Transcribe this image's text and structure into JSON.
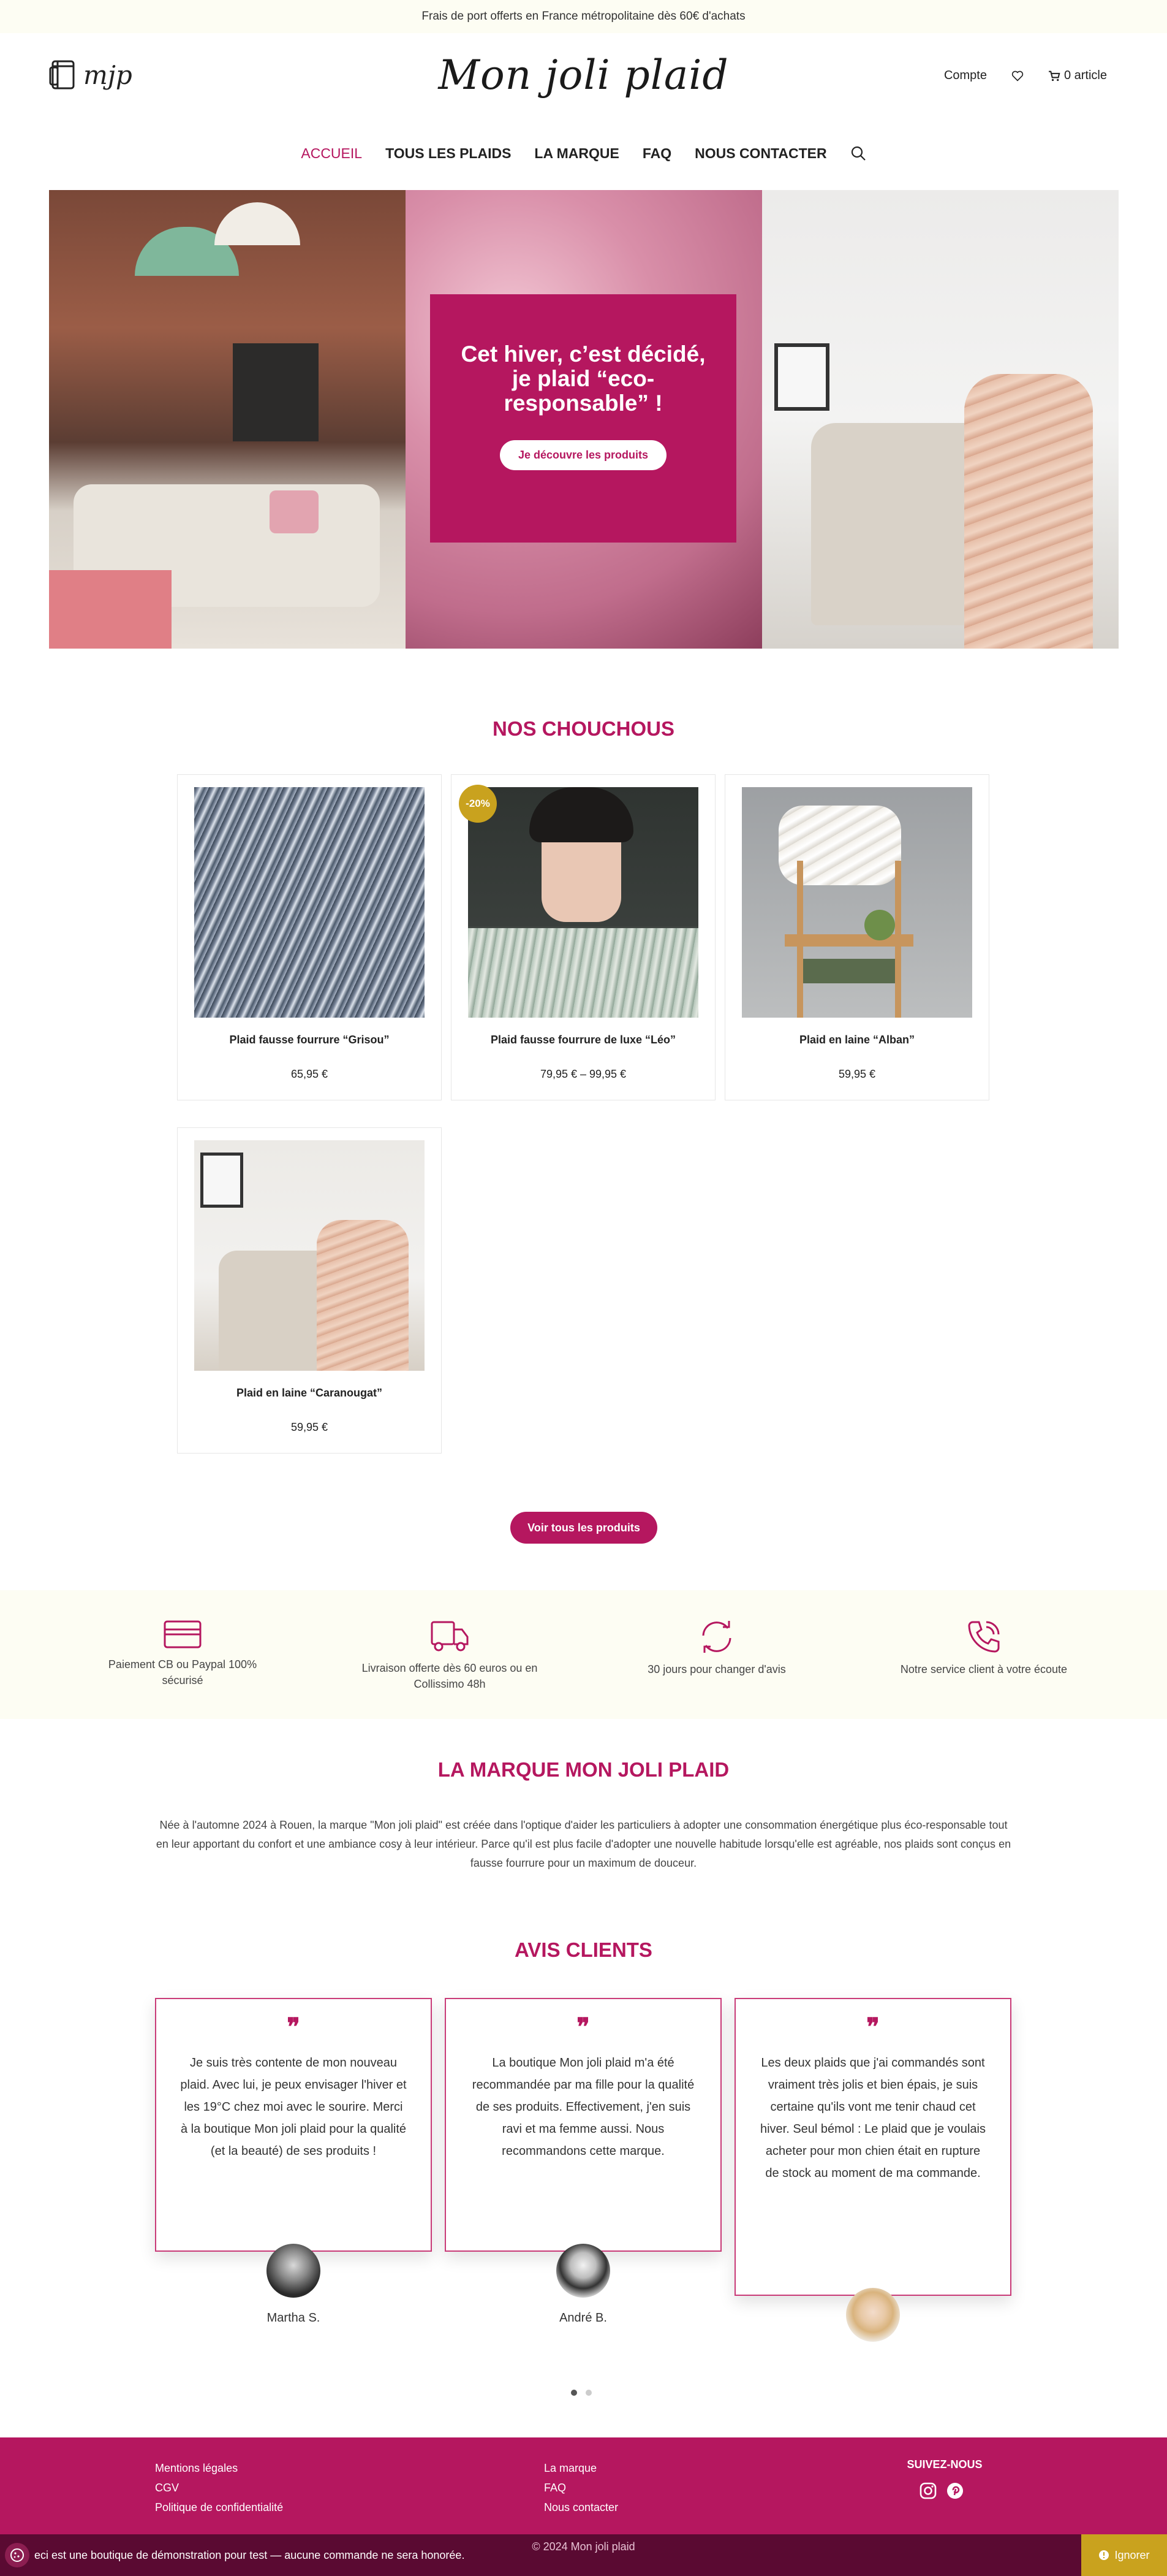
{
  "topbar": {
    "text": "Frais de port offerts en France métropolitaine dès 60€ d'achats"
  },
  "header": {
    "logo_text": "mjp",
    "brand": "Mon joli plaid",
    "account": "Compte",
    "cart": "0 article"
  },
  "nav": {
    "items": [
      {
        "label": "ACCUEIL"
      },
      {
        "label": "TOUS LES PLAIDS"
      },
      {
        "label": "LA MARQUE"
      },
      {
        "label": "FAQ"
      },
      {
        "label": "NOUS CONTACTER"
      }
    ]
  },
  "hero": {
    "title": "Cet hiver, c’est décidé, je plaid “eco-responsable” !",
    "button": "Je découvre les produits"
  },
  "favorites": {
    "title": "NOS CHOUCHOUS",
    "products": [
      {
        "name": "Plaid fausse fourrure “Grisou”",
        "price": "65,95 €"
      },
      {
        "name": "Plaid fausse fourrure de luxe “Léo”",
        "price": "79,95 € – 99,95 €",
        "badge": "-20%"
      },
      {
        "name": "Plaid en laine “Alban”",
        "price": "59,95 €"
      },
      {
        "name": "Plaid en laine “Caranougat”",
        "price": "59,95 €"
      }
    ],
    "all_button": "Voir tous les produits"
  },
  "features": [
    {
      "icon": "credit-card-icon",
      "text": "Paiement CB ou Paypal 100% sécurisé"
    },
    {
      "icon": "truck-icon",
      "text": "Livraison offerte dès 60 euros ou en Collissimo 48h"
    },
    {
      "icon": "refresh-icon",
      "text": "30 jours pour changer d'avis"
    },
    {
      "icon": "phone-icon",
      "text": "Notre service client à votre écoute"
    }
  ],
  "brand_section": {
    "title": "LA MARQUE MON JOLI PLAID",
    "text": "Née à l'automne 2024 à Rouen, la marque \"Mon joli plaid\" est créée dans l'optique d'aider les particuliers à adopter une consommation énergétique plus éco-responsable tout en leur apportant du confort et une ambiance cosy à leur intérieur. Parce qu'il est plus facile d'adopter une nouvelle habitude lorsqu'elle est agréable, nos plaids sont conçus en fausse fourrure pour un maximum de douceur."
  },
  "reviews": {
    "title": "AVIS CLIENTS",
    "items": [
      {
        "text": "Je suis très contente de mon nouveau plaid. Avec lui, je peux envisager l'hiver et les 19°C chez moi avec le sourire. Merci à la boutique Mon joli plaid pour la qualité (et la beauté) de ses produits !",
        "author": "Martha S."
      },
      {
        "text": "La boutique Mon joli plaid m'a été recommandée par ma fille pour la qualité de ses produits. Effectivement, j'en suis ravi et ma femme aussi. Nous recommandons cette marque.",
        "author": "André B."
      },
      {
        "text": "Les deux plaids que j'ai commandés sont vraiment très jolis et bien épais, je suis certaine qu'ils vont me tenir chaud cet hiver. Seul bémol : Le plaid que je voulais acheter pour mon chien était en rupture de stock au moment de ma commande.",
        "author": ""
      }
    ]
  },
  "footer": {
    "col1": [
      "Mentions légales",
      "CGV",
      "Politique de confidentialité"
    ],
    "col2": [
      "La marque",
      "FAQ",
      "Nous contacter"
    ],
    "follow": "SUIVEZ-NOUS",
    "copyright": "© 2024 Mon joli plaid"
  },
  "demo_notice": {
    "text": "eci est une boutique de démonstration pour test — aucune commande ne sera honorée.",
    "ignore": "Ignorer"
  },
  "colors": {
    "accent": "#b5175f",
    "badge": "#c9a21e",
    "topbar_bg": "#fdfdf3"
  }
}
